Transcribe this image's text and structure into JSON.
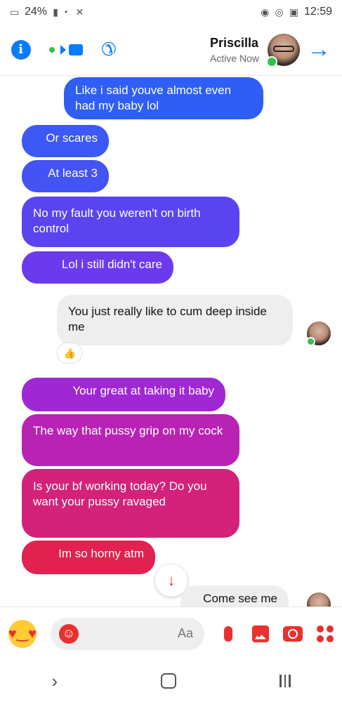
{
  "status_bar": {
    "time": "12:59",
    "battery": "24%"
  },
  "header": {
    "contact_name": "Priscilla",
    "contact_status": "Active Now"
  },
  "messages": [
    {
      "text": "Like i said youve almost even had my baby lol",
      "direction": "outgoing",
      "color": "#2f5ef5"
    },
    {
      "text": "Or scares",
      "direction": "outgoing",
      "color": "#3c58f5"
    },
    {
      "text": "At least 3",
      "direction": "outgoing",
      "color": "#4453f3"
    },
    {
      "text": "No my fault you weren't on birth control",
      "direction": "outgoing",
      "color": "#5a44f0"
    },
    {
      "text": "Lol i still didn't care",
      "direction": "outgoing",
      "color": "#6c3aed"
    },
    {
      "text": "You just really like to cum deep inside me",
      "direction": "incoming",
      "color": "#eeeeee"
    },
    {
      "text": "Your great at taking it baby",
      "direction": "outgoing",
      "color": "#a027d4"
    },
    {
      "text": "The way that pussy grip on my cock",
      "direction": "outgoing",
      "color": "#b923b4"
    },
    {
      "text": "Is your bf working today? Do you want your pussy ravaged",
      "direction": "outgoing",
      "color": "#d42179"
    },
    {
      "text": "Im so horny atm",
      "direction": "outgoing",
      "color": "#e1214f"
    },
    {
      "text": "Come see me",
      "direction": "incoming",
      "color": "#eeeeee"
    }
  ],
  "composer": {
    "placeholder": "Aa"
  },
  "colors": {
    "accent_blue": "#0a7cff",
    "accent_red": "#e8312f",
    "online_green": "#31c24b"
  }
}
